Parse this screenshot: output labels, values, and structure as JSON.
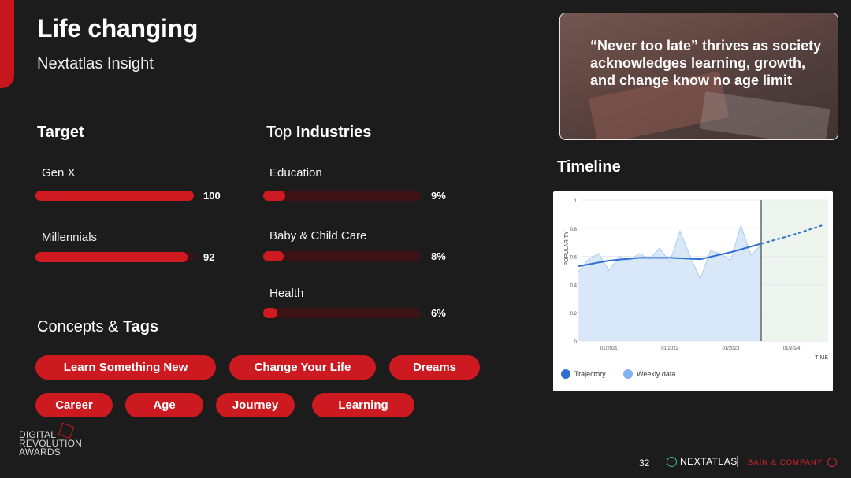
{
  "slide": {
    "title": "Life changing",
    "subtitle": "Nextatlas Insight",
    "accent_color": "#c8161d"
  },
  "target": {
    "heading": "Target",
    "bars": [
      {
        "label": "Gen X",
        "value": 100,
        "value_text": "100"
      },
      {
        "label": "Millennials",
        "value": 92,
        "value_text": "92"
      }
    ]
  },
  "industries": {
    "heading_prefix": "Top ",
    "heading_bold": "Industries",
    "bars": [
      {
        "label": "Education",
        "value": 9,
        "value_text": "9%"
      },
      {
        "label": "Baby & Child Care",
        "value": 8,
        "value_text": "8%"
      },
      {
        "label": "Health",
        "value": 6,
        "value_text": "6%"
      }
    ]
  },
  "concepts": {
    "heading_prefix": "Concepts & ",
    "heading_bold": "Tags",
    "tags": [
      "Learn Something New",
      "Change Your Life",
      "Dreams",
      "Career",
      "Age",
      "Journey",
      "Learning"
    ]
  },
  "quote": {
    "text": "“Never too late” thrives as society acknowledges learning, growth, and change know no age limit"
  },
  "timeline": {
    "heading": "Timeline",
    "legend": [
      {
        "label": "Trajectory",
        "color": "#2e6fd0"
      },
      {
        "label": "Weekly data",
        "color": "#7fb2ee"
      }
    ]
  },
  "chart_data": {
    "type": "line",
    "title": "",
    "xlabel": "TIME",
    "ylabel": "POPULARITY",
    "ylim": [
      0,
      1
    ],
    "y_ticks": [
      "0",
      "0.2",
      "0.4",
      "0.6",
      "0.8",
      "1"
    ],
    "x_ticks": [
      "01/2021",
      "01/2022",
      "01/2023",
      "01/2024"
    ],
    "grid": true,
    "legend_position": "bottom-left",
    "series": [
      {
        "name": "Weekly data",
        "style": "area",
        "x": [
          "2020-07",
          "2020-09",
          "2020-11",
          "2021-01",
          "2021-03",
          "2021-05",
          "2021-07",
          "2021-09",
          "2021-11",
          "2022-01",
          "2022-03",
          "2022-05",
          "2022-07",
          "2022-09",
          "2022-11",
          "2023-01",
          "2023-03",
          "2023-05",
          "2023-07"
        ],
        "values": [
          0.49,
          0.58,
          0.62,
          0.5,
          0.6,
          0.57,
          0.62,
          0.58,
          0.66,
          0.56,
          0.78,
          0.6,
          0.44,
          0.64,
          0.62,
          0.57,
          0.82,
          0.61,
          0.68
        ]
      },
      {
        "name": "Trajectory",
        "style": "line",
        "x": [
          "2020-07",
          "2021-01",
          "2021-07",
          "2022-01",
          "2022-07",
          "2023-01",
          "2023-07"
        ],
        "values": [
          0.53,
          0.57,
          0.59,
          0.59,
          0.58,
          0.63,
          0.69
        ]
      },
      {
        "name": "Trajectory forecast",
        "style": "dashed",
        "x": [
          "2023-07",
          "2024-01",
          "2024-07"
        ],
        "values": [
          0.69,
          0.75,
          0.82
        ]
      }
    ],
    "forecast_start": "2023-07"
  },
  "footer": {
    "award_lines": [
      "DIGITAL",
      "REVOLUTION",
      "AWARDS"
    ],
    "page_number": "32",
    "brand_primary": "NEXTATLAS",
    "brand_secondary": "BAIN & COMPANY"
  }
}
